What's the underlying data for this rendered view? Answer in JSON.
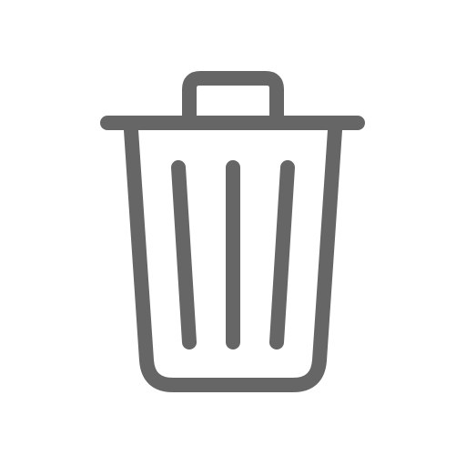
{
  "icon": {
    "name": "trash-icon",
    "color": "#666666",
    "background": "#ffffff"
  }
}
